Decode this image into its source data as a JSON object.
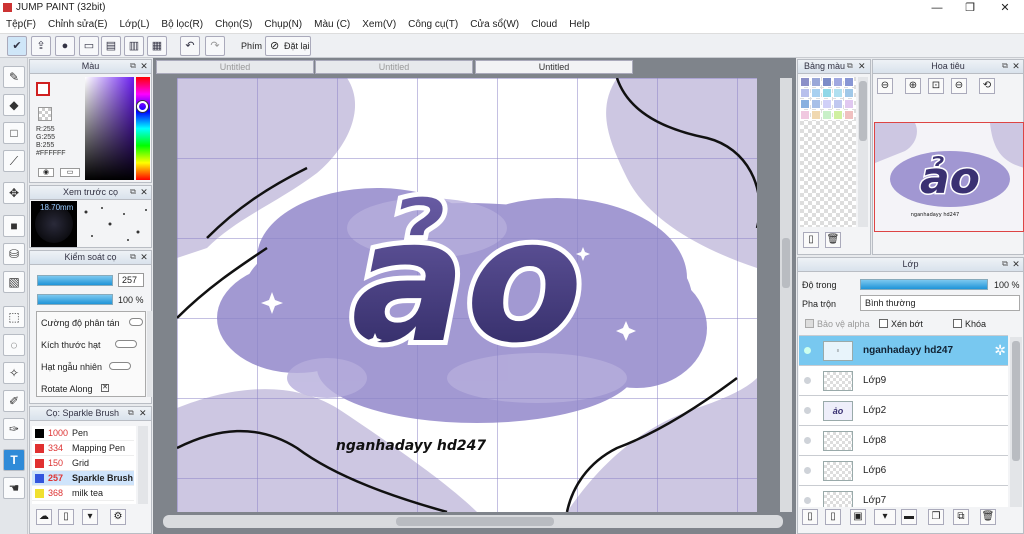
{
  "app": {
    "title": "JUMP PAINT (32bit)",
    "window_controls": [
      "—",
      "❐",
      "✕"
    ]
  },
  "menu": [
    "Tệp(F)",
    "Chỉnh sửa(E)",
    "Lớp(L)",
    "Bộ lọc(R)",
    "Chọn(S)",
    "Chụp(N)",
    "Màu (C)",
    "Xem(V)",
    "Công cụ(T)",
    "Cửa sổ(W)",
    "Cloud",
    "Help"
  ],
  "toolbar": {
    "phim_label": "Phím",
    "reset_label": "Đặt lại"
  },
  "color_panel": {
    "title": "Màu",
    "r": "R:255",
    "g": "G:255",
    "b": "B:255",
    "hex": "#FFFFFF"
  },
  "brush_preview": {
    "title": "Xem trước cọ",
    "size": "18.70mm"
  },
  "brush_control": {
    "title": "Kiểm soát cọ",
    "size_value": "257",
    "opacity_value": "100 %",
    "items": [
      "Cường độ phân tán",
      "Kích thước hạt",
      "Hạt ngẫu nhiên",
      "Rotate Along"
    ]
  },
  "brush_list": {
    "title": "Cọ: Sparkle Brush",
    "items": [
      {
        "size": "1000",
        "name": "Pen",
        "color": "#000000"
      },
      {
        "size": "334",
        "name": "Mapping Pen",
        "color": "#e03030"
      },
      {
        "size": "150",
        "name": "Grid",
        "color": "#e03030"
      },
      {
        "size": "257",
        "name": "Sparkle Brush",
        "color": "#3355dd"
      },
      {
        "size": "368",
        "name": "milk tea",
        "color": "#f0e030"
      }
    ]
  },
  "tabs": [
    "Untitled",
    "Untitled",
    "Untitled"
  ],
  "artwork": {
    "title_text": "ảo",
    "caption": "nganhadayy hd247"
  },
  "palette_panel": {
    "title": "Bảng màu"
  },
  "navigator_panel": {
    "title": "Hoa tiêu"
  },
  "layer_panel": {
    "title": "Lớp",
    "opacity_label": "Độ trong",
    "opacity_value": "100 %",
    "blend_label": "Pha trộn",
    "blend_value": "Bình thường",
    "alpha_protect": "Bảo vệ alpha",
    "clipping": "Xén bớt",
    "lock": "Khóa",
    "layers": [
      "nganhadayy hd247",
      "Lớp9",
      "Lớp2",
      "Lớp8",
      "Lớp6",
      "Lớp7"
    ]
  },
  "colors": {
    "accent": "#78c8f0",
    "purple": "#7e72b4",
    "dark_purple": "#332c64"
  }
}
